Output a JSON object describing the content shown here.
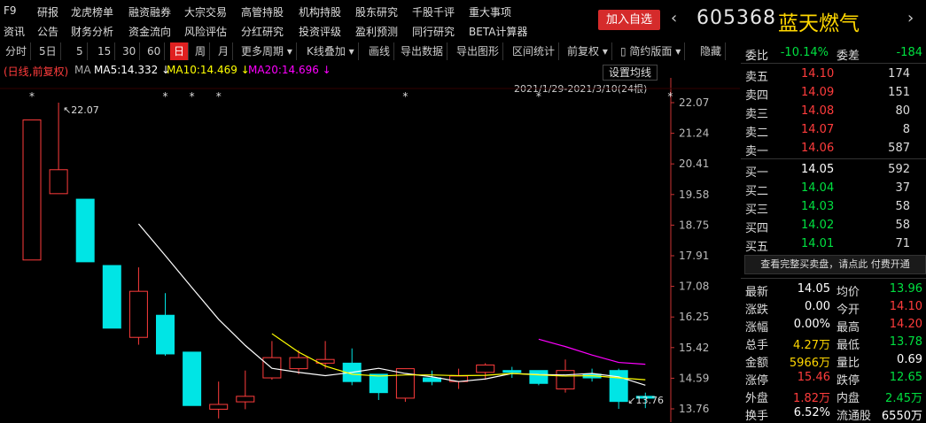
{
  "menu": {
    "f9": "F9",
    "row1": [
      "研报",
      "龙虎榜单",
      "融资融券",
      "大宗交易",
      "高管持股",
      "机构持股",
      "股东研究",
      "千股千评",
      "重大事项"
    ],
    "row2": [
      "资讯",
      "公告",
      "财务分析",
      "资金流向",
      "风险评估",
      "分红研究",
      "投资评级",
      "盈利预测",
      "同行研究",
      "BETA计算器"
    ]
  },
  "header": {
    "add_watchlist": "加入自选",
    "code": "605368",
    "name": "蓝天燃气",
    "prev_arrow": "‹",
    "next_arrow": "›"
  },
  "toolbar": {
    "items": [
      "分时",
      "5日",
      "5",
      "15",
      "30",
      "60",
      "日",
      "周",
      "月",
      "更多周期 ▾",
      "K线叠加 ▾",
      "画线",
      "导出数据",
      "导出图形",
      "区间统计",
      "前复权 ▾",
      "▯ 简约版面 ▾",
      "隐藏"
    ],
    "active": "日"
  },
  "legend": {
    "mode": "(日线,前复权)",
    "ma": "MA",
    "ma5": "MA5:14.332 ↓",
    "ma10": "MA10:14.469 ↓",
    "ma20": "MA20:14.696 ↓",
    "settings": "设置均线",
    "date_range": "2021/1/29-2021/3/10(24根)"
  },
  "colors": {
    "up": "#ff3c3c",
    "down": "#00e5e5",
    "ma5": "#ffffff",
    "ma10": "#ffff00",
    "ma20": "#ff00ff",
    "axis": "#cc3333"
  },
  "chart_data": {
    "type": "candlestick",
    "y_ticks": [
      "22.07",
      "21.24",
      "20.41",
      "19.58",
      "18.75",
      "17.91",
      "17.08",
      "16.25",
      "15.42",
      "14.59",
      "13.76"
    ],
    "ylim": [
      13.6,
      23.0
    ],
    "high_label": "22.07",
    "low_label": "13.76",
    "candles": [
      {
        "o": 17.8,
        "c": 21.6,
        "h": 21.6,
        "l": 17.8
      },
      {
        "o": 19.6,
        "c": 20.25,
        "h": 22.07,
        "l": 19.6
      },
      {
        "o": 19.45,
        "c": 17.75,
        "h": 19.45,
        "l": 17.75
      },
      {
        "o": 17.65,
        "c": 15.95,
        "h": 17.65,
        "l": 15.95
      },
      {
        "o": 15.7,
        "c": 16.95,
        "h": 17.6,
        "l": 15.5
      },
      {
        "o": 16.3,
        "c": 15.25,
        "h": 16.9,
        "l": 15.2
      },
      {
        "o": 15.3,
        "c": 13.85,
        "h": 15.3,
        "l": 13.85
      },
      {
        "o": 13.75,
        "c": 13.88,
        "h": 14.5,
        "l": 13.5
      },
      {
        "o": 13.95,
        "c": 14.1,
        "h": 14.8,
        "l": 13.75
      },
      {
        "o": 14.6,
        "c": 15.15,
        "h": 15.6,
        "l": 14.55
      },
      {
        "o": 14.85,
        "c": 15.15,
        "h": 15.35,
        "l": 14.7
      },
      {
        "o": 15.0,
        "c": 15.1,
        "h": 15.6,
        "l": 14.85
      },
      {
        "o": 15.0,
        "c": 14.5,
        "h": 15.4,
        "l": 14.4
      },
      {
        "o": 14.7,
        "c": 14.2,
        "h": 14.7,
        "l": 14.0
      },
      {
        "o": 14.05,
        "c": 14.85,
        "h": 14.85,
        "l": 13.95
      },
      {
        "o": 14.6,
        "c": 14.5,
        "h": 14.8,
        "l": 14.4
      },
      {
        "o": 14.5,
        "c": 14.65,
        "h": 14.85,
        "l": 14.3
      },
      {
        "o": 14.75,
        "c": 14.95,
        "h": 15.0,
        "l": 14.55
      },
      {
        "o": 14.8,
        "c": 14.75,
        "h": 14.9,
        "l": 14.6
      },
      {
        "o": 14.8,
        "c": 14.45,
        "h": 14.8,
        "l": 14.4
      },
      {
        "o": 14.3,
        "c": 14.8,
        "h": 15.1,
        "l": 14.2
      },
      {
        "o": 14.7,
        "c": 14.6,
        "h": 14.85,
        "l": 14.5
      },
      {
        "o": 14.8,
        "c": 13.96,
        "h": 14.85,
        "l": 13.76
      },
      {
        "o": 14.1,
        "c": 14.05,
        "h": 14.2,
        "l": 13.78
      }
    ],
    "ma5": [
      null,
      null,
      null,
      null,
      18.78,
      17.92,
      17.05,
      16.19,
      15.48,
      14.86,
      14.75,
      14.66,
      14.75,
      14.86,
      14.72,
      14.63,
      14.5,
      14.57,
      14.72,
      14.69,
      14.68,
      14.72,
      14.63,
      14.4
    ],
    "ma10": [
      null,
      null,
      null,
      null,
      null,
      null,
      null,
      null,
      null,
      15.8,
      15.3,
      14.92,
      14.7,
      14.65,
      14.68,
      14.68,
      14.66,
      14.67,
      14.72,
      14.68,
      14.65,
      14.66,
      14.6,
      14.55
    ],
    "ma20": [
      null,
      null,
      null,
      null,
      null,
      null,
      null,
      null,
      null,
      null,
      null,
      null,
      null,
      null,
      null,
      null,
      null,
      null,
      null,
      15.65,
      15.45,
      15.22,
      15.02,
      14.97
    ],
    "markers": [
      0,
      5,
      6,
      7,
      14,
      19,
      24
    ]
  },
  "quote": {
    "ratio_label": "委比",
    "ratio_value": "-10.14%",
    "diff_label": "委差",
    "diff_value": "-184",
    "asks": [
      {
        "label": "卖五",
        "price": "14.10",
        "vol": "174"
      },
      {
        "label": "卖四",
        "price": "14.09",
        "vol": "151"
      },
      {
        "label": "卖三",
        "price": "14.08",
        "vol": "80"
      },
      {
        "label": "卖二",
        "price": "14.07",
        "vol": "8"
      },
      {
        "label": "卖一",
        "price": "14.06",
        "vol": "587"
      }
    ],
    "bids": [
      {
        "label": "买一",
        "price": "14.05",
        "vol": "592"
      },
      {
        "label": "买二",
        "price": "14.04",
        "vol": "37"
      },
      {
        "label": "买三",
        "price": "14.03",
        "vol": "58"
      },
      {
        "label": "买四",
        "price": "14.02",
        "vol": "58"
      },
      {
        "label": "买五",
        "price": "14.01",
        "vol": "71"
      }
    ],
    "promo": "查看完整买卖盘，请点此 付费开通",
    "stats": [
      {
        "l1": "最新",
        "v1": "14.05",
        "c1": "#ffffff",
        "l2": "均价",
        "v2": "13.96",
        "c2": "#00e040"
      },
      {
        "l1": "涨跌",
        "v1": "0.00",
        "c1": "#ffffff",
        "l2": "今开",
        "v2": "14.10",
        "c2": "#ff3c3c"
      },
      {
        "l1": "涨幅",
        "v1": "0.00%",
        "c1": "#ffffff",
        "l2": "最高",
        "v2": "14.20",
        "c2": "#ff3c3c"
      },
      {
        "l1": "总手",
        "v1": "4.27万",
        "c1": "#ffd700",
        "l2": "最低",
        "v2": "13.78",
        "c2": "#00e040"
      },
      {
        "l1": "金额",
        "v1": "5966万",
        "c1": "#ffd700",
        "l2": "量比",
        "v2": "0.69",
        "c2": "#ffffff"
      },
      {
        "l1": "涨停",
        "v1": "15.46",
        "c1": "#ff3c3c",
        "l2": "跌停",
        "v2": "12.65",
        "c2": "#00e040"
      },
      {
        "l1": "外盘",
        "v1": "1.82万",
        "c1": "#ff3c3c",
        "l2": "内盘",
        "v2": "2.45万",
        "c2": "#00e040"
      },
      {
        "l1": "换手",
        "v1": "6.52%",
        "c1": "#ffffff",
        "l2": "流通股",
        "v2": "6550万",
        "c2": "#ffffff"
      }
    ]
  }
}
